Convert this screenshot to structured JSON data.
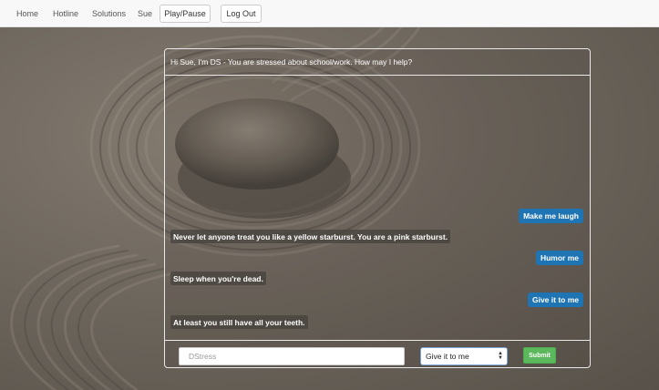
{
  "nav": {
    "links": [
      "Home",
      "Hotline",
      "Solutions",
      "Sue"
    ],
    "play_pause_label": "Play/Pause",
    "logout_label": "Log Out"
  },
  "chat": {
    "header": "Hi Sue, I'm DS - You are stressed about school/work. How may I help?",
    "messages": [
      {
        "from": "user",
        "text": "Make me laugh"
      },
      {
        "from": "bot",
        "text": "Never let anyone treat you like a yellow starburst. You are a pink starburst."
      },
      {
        "from": "user",
        "text": "Humor me"
      },
      {
        "from": "bot",
        "text": "Sleep when you're dead."
      },
      {
        "from": "user",
        "text": "Give it to me"
      },
      {
        "from": "bot",
        "text": "At least you still have all your teeth."
      }
    ]
  },
  "composer": {
    "input_placeholder": "DStress",
    "selected_option": "Give it to me",
    "submit_label": "Submit"
  },
  "colors": {
    "user_bubble": "#1f74b4",
    "submit_button": "#5cb85c"
  }
}
